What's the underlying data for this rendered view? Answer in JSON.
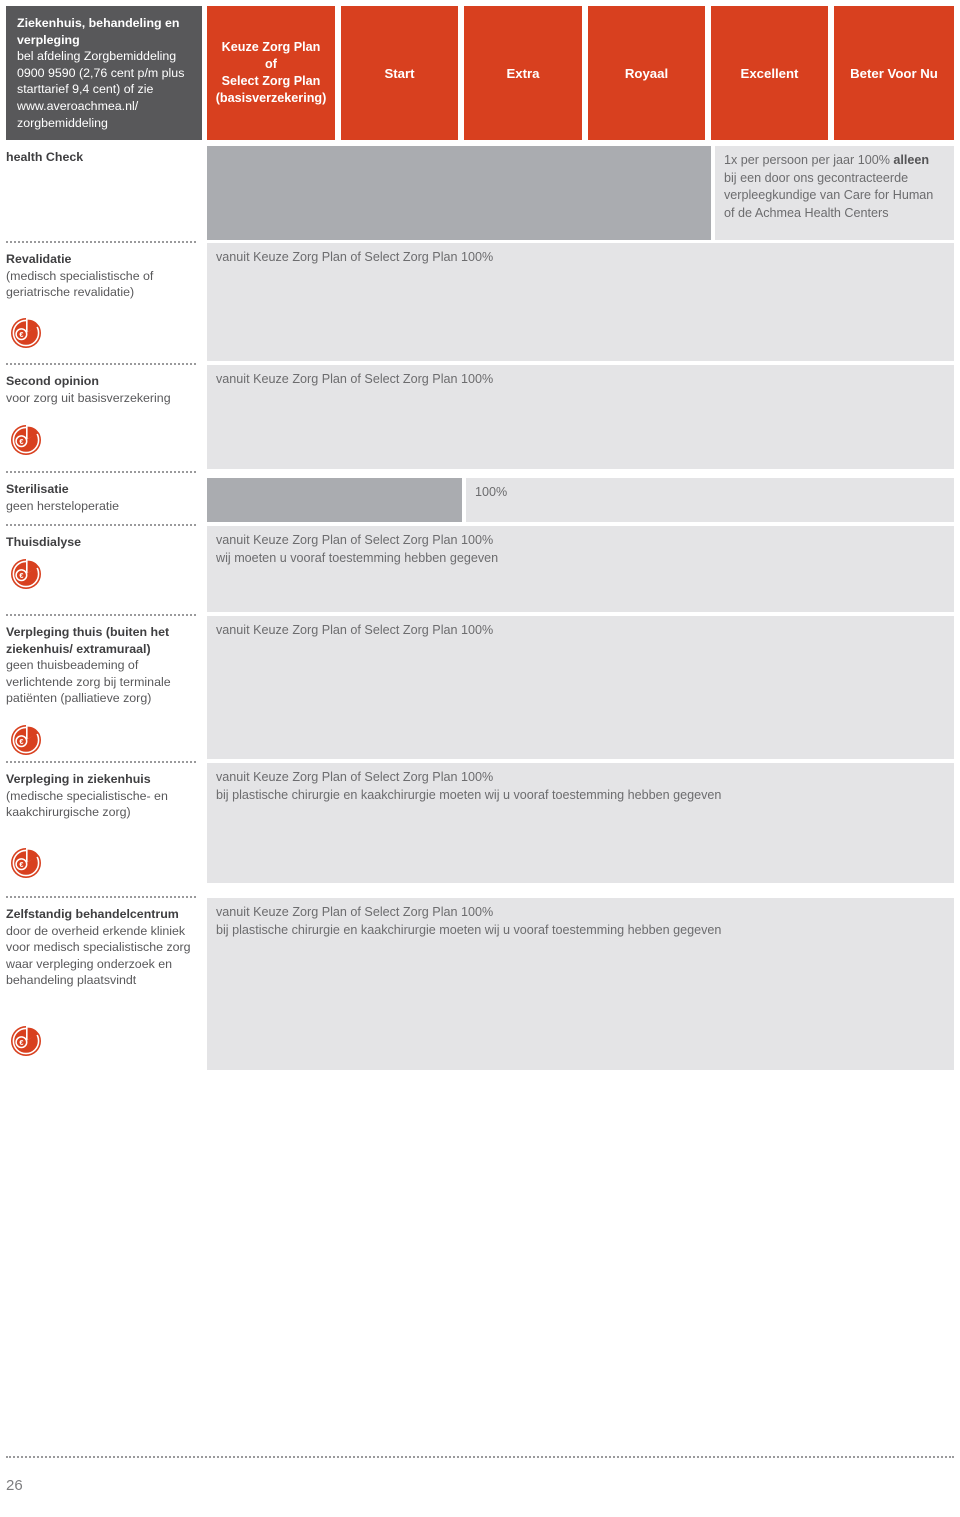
{
  "header": {
    "title_line1": "Ziekenhuis, behandeling en",
    "title_line2": "verpleging",
    "title_rest": "bel afdeling Zorgbemiddeling 0900 9590 (2,76 cent p/m plus starttarief 9,4 cent) of zie www.averoachmea.nl/ zorgbemiddeling",
    "columns": [
      {
        "label": "Keuze Zorg Plan\nof\nSelect Zorg Plan\n(basisverzekering)",
        "name": "keuze-select-zorg-plan"
      },
      {
        "label": "Start",
        "name": "start"
      },
      {
        "label": "Extra",
        "name": "extra"
      },
      {
        "label": "Royaal",
        "name": "royaal"
      },
      {
        "label": "Excellent",
        "name": "excellent"
      },
      {
        "label": "Beter Voor Nu",
        "name": "beter-voor-nu"
      }
    ]
  },
  "rows": [
    {
      "name": "health-check",
      "title": "health Check",
      "subtitle": "",
      "has_euro_icon": false,
      "beter_voor_nu": {
        "line_plain_1": "1x per persoon per jaar 100% ",
        "line_bold": "alleen",
        "line_rest": "bij een door ons gecontracteerde verpleegkundige van Care for Human of de Achmea Health Centers"
      }
    },
    {
      "name": "revalidatie",
      "title": "Revalidatie",
      "subtitle": "(medisch specialistische of geriatrische revalidatie)",
      "has_euro_icon": true,
      "value": "vanuit Keuze Zorg Plan of Select Zorg Plan 100%"
    },
    {
      "name": "second-opinion",
      "title": "Second opinion",
      "subtitle": "voor zorg uit basisverzekering",
      "has_euro_icon": true,
      "value": "vanuit Keuze Zorg Plan of Select Zorg Plan 100%"
    },
    {
      "name": "sterilisatie",
      "title": "Sterilisatie",
      "subtitle": "geen hersteloperatie",
      "has_euro_icon": false,
      "value": "100%"
    },
    {
      "name": "thuisdialyse",
      "title": "Thuisdialyse",
      "subtitle": "",
      "has_euro_icon": true,
      "value": "vanuit Keuze Zorg Plan of Select Zorg Plan 100%",
      "value2": "wij moeten u vooraf toestemming hebben gegeven"
    },
    {
      "name": "verpleging-thuis",
      "title": "Verpleging thuis (buiten het ziekenhuis/ extramuraal)",
      "subtitle": "geen thuisbeademing of verlichtende zorg bij terminale patiënten (palliatieve zorg)",
      "has_euro_icon": true,
      "value": "vanuit Keuze Zorg Plan of Select Zorg Plan 100%"
    },
    {
      "name": "verpleging-in-ziekenhuis",
      "title": "Verpleging in ziekenhuis",
      "subtitle": "(medische specialistische- en kaakchirurgische zorg)",
      "has_euro_icon": true,
      "value": "vanuit Keuze Zorg Plan of Select Zorg Plan 100%",
      "value2": "bij plastische chirurgie en kaakchirurgie moeten wij u vooraf toestemming hebben gegeven"
    },
    {
      "name": "zelfstandig-behandelcentrum",
      "title": "Zelfstandig behandelcentrum",
      "subtitle": "door de overheid erkende kliniek voor medisch specialistische zorg waar verpleging onderzoek en behandeling plaatsvindt",
      "has_euro_icon": true,
      "value": "vanuit Keuze Zorg Plan of Select Zorg Plan 100%",
      "value2": "bij plastische chirurgie en kaakchirurgie moeten wij u vooraf toestemming hebben gegeven"
    }
  ],
  "footer": {
    "page_number": "26"
  },
  "colors": {
    "brand_red": "#d8401f",
    "header_gray": "#58585a",
    "cell_light": "#e4e4e6",
    "cell_dark": "#aaacb0",
    "text_gray": "#6c6c6e"
  },
  "icons": {
    "euro_pie": "euro-pie-icon"
  }
}
